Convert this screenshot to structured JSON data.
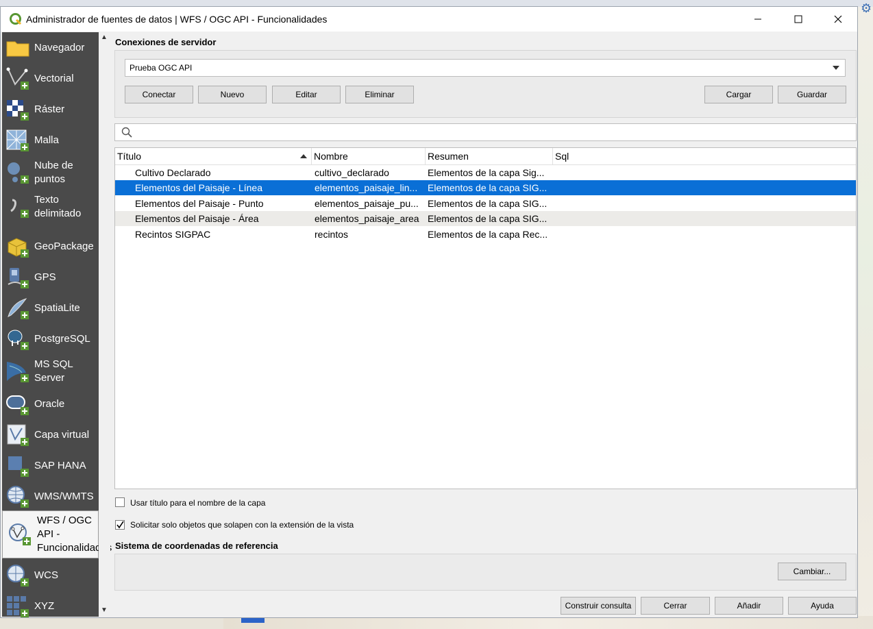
{
  "window": {
    "title": "Administrador de fuentes de datos | WFS / OGC API - Funcionalidades"
  },
  "sidebar": {
    "items": [
      {
        "label": "Navegador",
        "icon": "folder-icon"
      },
      {
        "label": "Vectorial",
        "icon": "vector-add-icon"
      },
      {
        "label": "Ráster",
        "icon": "raster-add-icon"
      },
      {
        "label": "Malla",
        "icon": "mesh-add-icon"
      },
      {
        "label_1": "Nube de",
        "label_2": "puntos",
        "icon": "pointcloud-add-icon"
      },
      {
        "label_1": "Texto",
        "label_2": "delimitado",
        "icon": "delimited-text-add-icon"
      },
      {
        "label": "GeoPackage",
        "icon": "geopackage-add-icon"
      },
      {
        "label": "GPS",
        "icon": "gps-add-icon"
      },
      {
        "label": "SpatiaLite",
        "icon": "spatialite-add-icon"
      },
      {
        "label": "PostgreSQL",
        "icon": "postgresql-add-icon"
      },
      {
        "label_1": "MS SQL",
        "label_2": "Server",
        "icon": "mssql-add-icon"
      },
      {
        "label": "Oracle",
        "icon": "oracle-add-icon"
      },
      {
        "label": "Capa virtual",
        "icon": "virtual-layer-add-icon"
      },
      {
        "label": "SAP HANA",
        "icon": "sap-hana-add-icon"
      },
      {
        "label": "WMS/WMTS",
        "icon": "wms-add-icon"
      },
      {
        "label_1": "WFS / OGC",
        "label_2": "API -",
        "label_3": "Funcionalidades",
        "icon": "wfs-add-icon",
        "active": true
      },
      {
        "label": "WCS",
        "icon": "wcs-add-icon"
      },
      {
        "label": "XYZ",
        "icon": "xyz-add-icon"
      }
    ]
  },
  "connections": {
    "section_label": "Conexiones de servidor",
    "selected": "Prueba OGC API",
    "buttons": {
      "connect": "Conectar",
      "new": "Nuevo",
      "edit": "Editar",
      "delete": "Eliminar",
      "load": "Cargar",
      "save": "Guardar"
    }
  },
  "search": {
    "placeholder": "",
    "value": ""
  },
  "table": {
    "columns": [
      "Título",
      "Nombre",
      "Resumen",
      "Sql"
    ],
    "sort_column": "Título",
    "rows": [
      {
        "title": "Cultivo Declarado",
        "name": "cultivo_declarado",
        "summary": "Elementos de la capa Sig...",
        "sql": ""
      },
      {
        "title": "Elementos del Paisaje - Línea",
        "name": "elementos_paisaje_lin...",
        "summary": "Elementos de la capa SIG...",
        "sql": "",
        "selected": true
      },
      {
        "title": "Elementos del Paisaje - Punto",
        "name": "elementos_paisaje_pu...",
        "summary": "Elementos de la capa SIG...",
        "sql": ""
      },
      {
        "title": "Elementos del Paisaje - Área",
        "name": "elementos_paisaje_area",
        "summary": "Elementos de la capa SIG...",
        "sql": ""
      },
      {
        "title": "Recintos SIGPAC",
        "name": "recintos",
        "summary": "Elementos de la capa Rec...",
        "sql": ""
      }
    ]
  },
  "options": {
    "use_title": {
      "label": "Usar título para el nombre de la capa",
      "checked": false
    },
    "only_extent": {
      "label": "Solicitar solo objetos que solapen con la extensión de la vista",
      "checked": true
    }
  },
  "crs": {
    "section_label": "Sistema de coordenadas de referencia",
    "change_button": "Cambiar..."
  },
  "footer": {
    "build_query": "Construir consulta",
    "close": "Cerrar",
    "add": "Añadir",
    "help": "Ayuda"
  },
  "colors": {
    "sidebar_bg": "#4a4a4a",
    "selection": "#0a6fd6",
    "qgis_green": "#589632"
  }
}
